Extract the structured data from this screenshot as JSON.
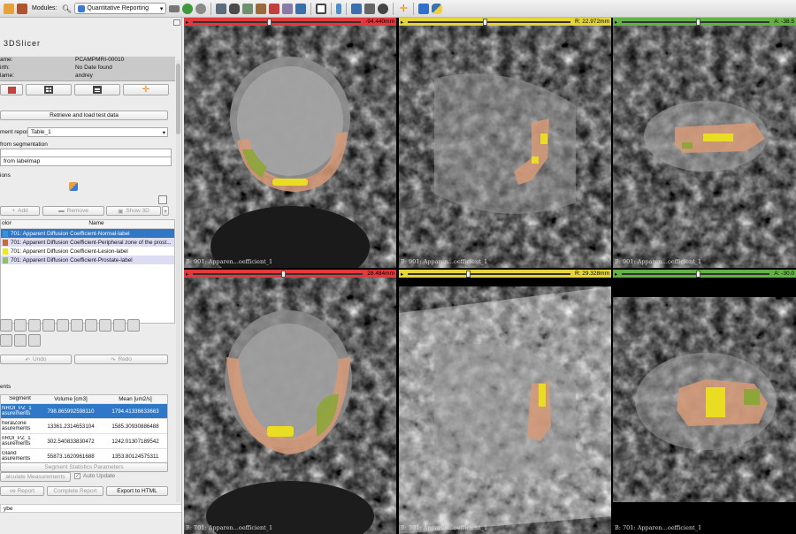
{
  "toolbar": {
    "modules_label": "Modules:",
    "module_selected": "Quantitative Reporting"
  },
  "panel": {
    "logo_text": "3DSlicer",
    "patient": {
      "name_label": "ame:",
      "name_value": "PCAMPMRI-00010",
      "birth_label": "irth:",
      "birth_value": "No Date found",
      "reader_label": "lame:",
      "reader_value": "andrey"
    },
    "retrieve_button": "Retrieve and load test data",
    "report_label": "ment report",
    "report_value": "Table_1",
    "from_segmentation": "from segmentation",
    "from_labelmap": "from labelmap",
    "segmentations_label": "ions",
    "add_button": "Add",
    "remove_button": "Remove",
    "show3d_button": "Show 3D",
    "seg_table_headers": [
      "olor",
      "Name"
    ],
    "segments": [
      {
        "name": "701: Apparent Diffusion Coefficient-Normal-label",
        "color": "#3a8fd8",
        "selected": true
      },
      {
        "name": "701: Apparent Diffusion Coefficient-Peripheral zone of the prost...",
        "color": "#c96a3c",
        "selected": false
      },
      {
        "name": "701: Apparent Diffusion Coefficient-Lesion-label",
        "color": "#f1e81c",
        "selected": false
      },
      {
        "name": "701: Apparent Diffusion Coefficient-Prostate-label",
        "color": "#8fbf6a",
        "selected": false
      }
    ],
    "undo_button": "Undo",
    "redo_button": "Redo",
    "measurements_label": "ents",
    "meas_headers": [
      "Segment",
      "Volume [cm3]",
      "Mean [um2/s]"
    ],
    "measurements": [
      {
        "segment": "NROI_PZ_1 asurements",
        "volume": "798.865992598110",
        "mean": "1794.41336633663"
      },
      {
        "segment": "heralZone asurements",
        "volume": "13361.2314653104",
        "mean": "1585.30930886488"
      },
      {
        "segment": "nROI_PZ_1 asurements",
        "volume": "302.540833830472",
        "mean": "1242.01307189542"
      },
      {
        "segment": "Gland asurements",
        "volume": "55873.1620961688",
        "mean": "1353.80124575311"
      }
    ],
    "seg_stats_button": "Segment Statistics Parameters",
    "calc_measurements": "alculate Measurements",
    "auto_update": "Auto Update",
    "save_report": "ve Report",
    "complete_report": "Complete Report",
    "export_html": "Export to HTML",
    "python_label": "ybe"
  },
  "views": [
    {
      "bar_text": "-94.440mm",
      "bar_color": "#e0393e",
      "label": "B: 901: Apparen...oefficient_1"
    },
    {
      "bar_text": "R: 22.972mm",
      "bar_color": "#e5d53a",
      "label": "B: 901: Apparen...oefficient_1"
    },
    {
      "bar_text": "A: -38.5",
      "bar_color": "#63b146",
      "label": "B: 901: Apparen...oefficient_1"
    },
    {
      "bar_text": "28.484mm",
      "bar_color": "#e0393e",
      "label": "B: 701: Apparen...oefficient_1"
    },
    {
      "bar_text": "R: 29.328mm",
      "bar_color": "#e5d53a",
      "label": "B: 701: Apparen...oefficient_1"
    },
    {
      "bar_text": "A: -30.0",
      "bar_color": "#63b146",
      "label": "B: 701: Apparen...oefficient_1"
    }
  ]
}
